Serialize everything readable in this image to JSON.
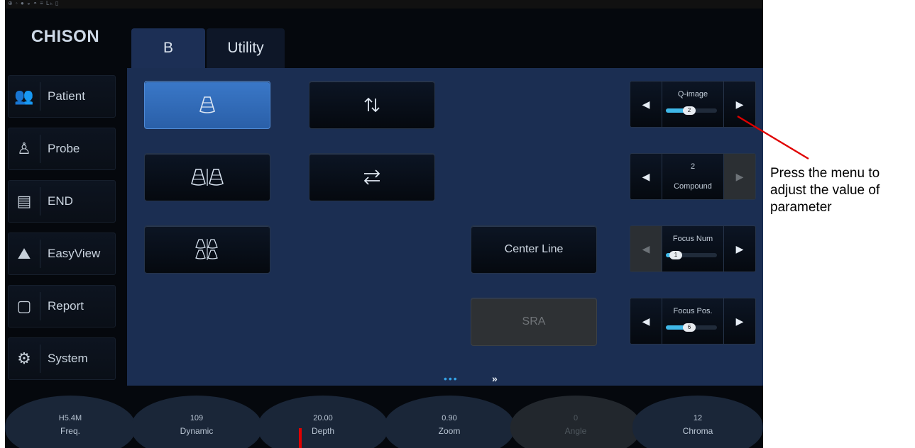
{
  "statusbar": {
    "icons": "⊕ ◦ ● ◒ ◓ ≡ Lₕ ▯"
  },
  "logo": "CHISON",
  "sidebar": {
    "items": [
      {
        "label": "Patient",
        "icon": "patient-icon",
        "glyph": "👥"
      },
      {
        "label": "Probe",
        "icon": "probe-icon",
        "glyph": "♙"
      },
      {
        "label": "END",
        "icon": "end-icon",
        "glyph": "▤"
      },
      {
        "label": "EasyView",
        "icon": "easyview-icon",
        "glyph": "⛰"
      },
      {
        "label": "Report",
        "icon": "report-icon",
        "glyph": "▢"
      },
      {
        "label": "System",
        "icon": "system-icon",
        "glyph": "⚙"
      }
    ]
  },
  "tabs": [
    {
      "label": "B"
    },
    {
      "label": "Utility"
    }
  ],
  "panel": {
    "center_line_label": "Center Line",
    "sra_label": "SRA",
    "controls": {
      "qimage": {
        "label": "Q-image",
        "value": "2",
        "level": 0.45
      },
      "compound": {
        "value": "2",
        "label": "Compound"
      },
      "focus_num": {
        "label": "Focus Num",
        "value": "1",
        "level": 0.1
      },
      "focus_pos": {
        "label": "Focus Pos.",
        "value": "6",
        "level": 0.45
      }
    },
    "pager": {
      "dots": "•••",
      "next": "»"
    }
  },
  "knobs": [
    {
      "value": "H5.4M",
      "name": "Freq."
    },
    {
      "value": "109",
      "name": "Dynamic"
    },
    {
      "value": "20.00",
      "name": "Depth"
    },
    {
      "value": "0.90",
      "name": "Zoom"
    },
    {
      "value": "0",
      "name": "Angle"
    },
    {
      "value": "12",
      "name": "Chroma"
    }
  ],
  "annotation": {
    "text": "Press the menu to adjust the value of parameter",
    "color": "#e00000"
  }
}
